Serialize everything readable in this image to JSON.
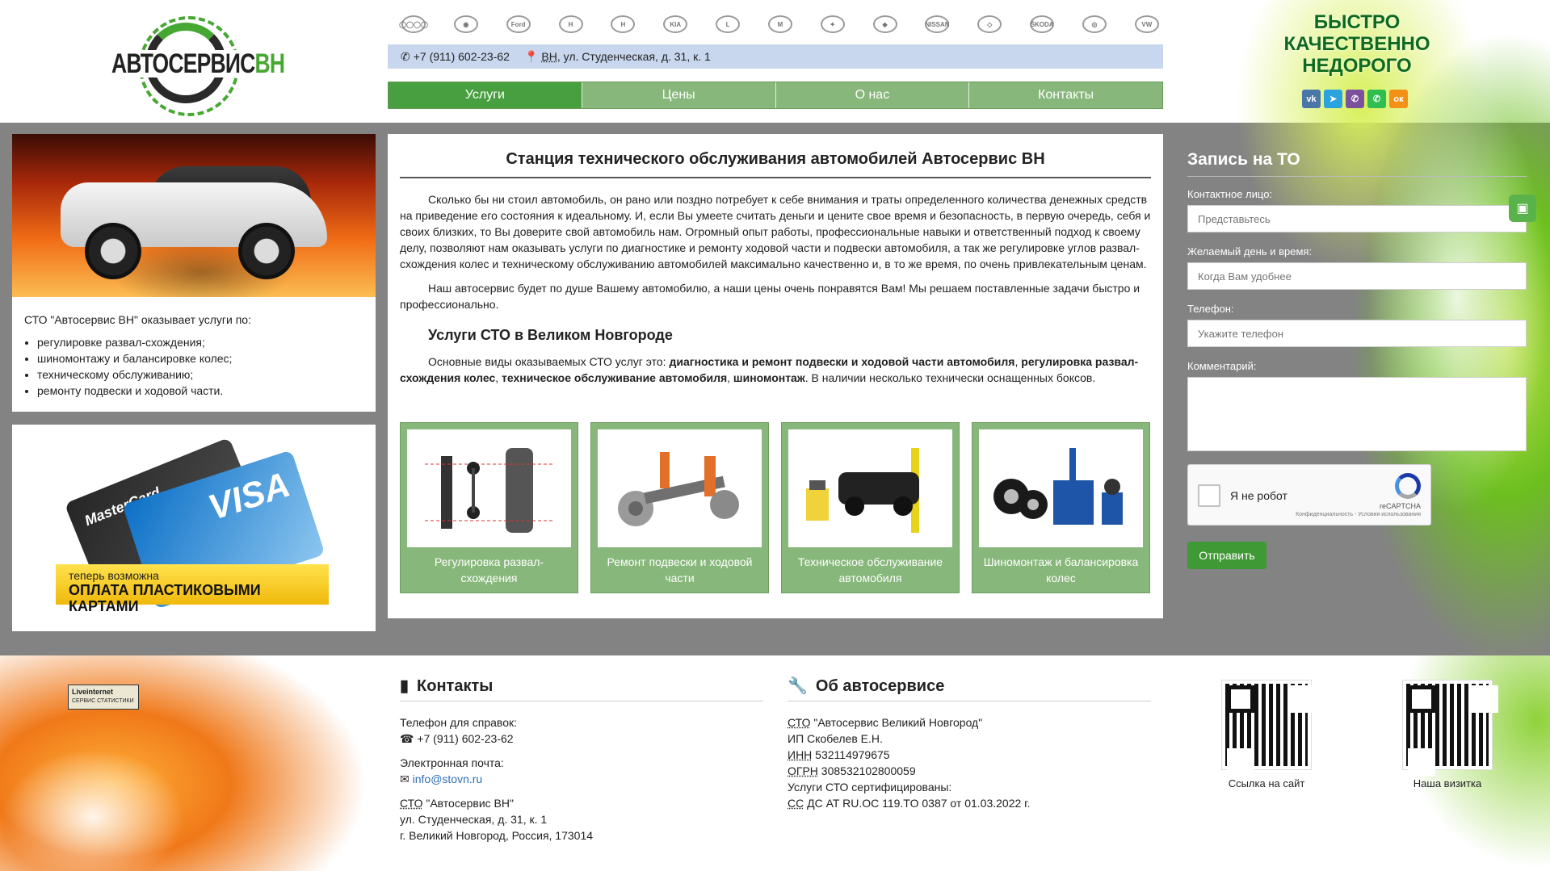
{
  "header": {
    "logo_word": "АВТОСЕРВИС",
    "logo_accent": "ВН",
    "brands": [
      {
        "name": "audi-logo-icon",
        "glyph": "◯◯◯◯"
      },
      {
        "name": "bmw-logo-icon",
        "glyph": "◉"
      },
      {
        "name": "ford-logo-icon",
        "glyph": "Ford"
      },
      {
        "name": "honda-logo-icon",
        "glyph": "H"
      },
      {
        "name": "hyundai-logo-icon",
        "glyph": "H"
      },
      {
        "name": "kia-logo-icon",
        "glyph": "KIA"
      },
      {
        "name": "lexus-logo-icon",
        "glyph": "L"
      },
      {
        "name": "mazda-logo-icon",
        "glyph": "M"
      },
      {
        "name": "mercedes-logo-icon",
        "glyph": "✦"
      },
      {
        "name": "mitsubishi-logo-icon",
        "glyph": "◆"
      },
      {
        "name": "nissan-logo-icon",
        "glyph": "NISSAN"
      },
      {
        "name": "renault-logo-icon",
        "glyph": "◇"
      },
      {
        "name": "skoda-logo-icon",
        "glyph": "ŠKODA"
      },
      {
        "name": "toyota-logo-icon",
        "glyph": "◎"
      },
      {
        "name": "volkswagen-logo-icon",
        "glyph": "VW"
      }
    ],
    "phone": "+7 (911) 602-23-62",
    "address_city": "ВН",
    "address_rest": ", ул. Студенческая, д. 31, к. 1",
    "nav": [
      "Услуги",
      "Цены",
      "О нас",
      "Контакты"
    ],
    "slogan": [
      "БЫСТРО",
      "КАЧЕСТВЕННО",
      "НЕДОРОГО"
    ],
    "social": [
      {
        "name": "vk-icon",
        "glyph": "vk",
        "color": "#4a76a8"
      },
      {
        "name": "telegram-icon",
        "glyph": "➤",
        "color": "#2aa3de"
      },
      {
        "name": "viber-icon",
        "glyph": "✆",
        "color": "#7b519d"
      },
      {
        "name": "whatsapp-icon",
        "glyph": "✆",
        "color": "#2fbe4f"
      },
      {
        "name": "odnoklassniki-icon",
        "glyph": "ок",
        "color": "#f29115"
      }
    ]
  },
  "left": {
    "intro": "СТО \"Автосервис ВН\" оказывает услуги по:",
    "services": [
      "регулировке развал-схождения;",
      "шиномонтажу и балансировке колес;",
      "техническому обслуживанию;",
      "ремонту подвески и ходовой части."
    ],
    "pay_line1": "теперь возможна",
    "pay_line2": "ОПЛАТА ПЛАСТИКОВЫМИ КАРТАМИ",
    "card_mc": "MasterCard",
    "card_visa": "VISA"
  },
  "main": {
    "title": "Станция технического обслуживания автомобилей Автосервис ВН",
    "p1": "Сколько бы ни стоил автомобиль, он рано или поздно потребует к себе внимания и траты определенного количества денежных средств на приведение его состояния к идеальному. И, если Вы умеете считать деньги и цените свое время и безопасность, в первую очередь, себя и своих близких, то Вы доверите свой автомобиль нам. Огромный опыт работы, профессиональные навыки и ответственный подход к своему делу, позволяют нам оказывать услуги по диагностике и ремонту ходовой части и подвески автомобиля, а так же регулировке углов развал-схождения колес и техническому обслуживанию автомобилей максимально качественно и, в то же время, по очень привлекательным ценам.",
    "p2": "Наш автосервис будет по душе Вашему автомобилю, а наши цены очень понравятся Вам! Мы решаем поставленные задачи быстро и профессионально.",
    "h2": "Услуги СТО в Великом Новгороде",
    "p3_start": "Основные виды оказываемых СТО услуг это: ",
    "p3_b1": "диагностика и ремонт подвески и ходовой части автомобиля",
    "p3_sep1": ", ",
    "p3_b2": "регулировка развал-схождения колес",
    "p3_sep2": ", ",
    "p3_b3": "техническое обслуживание автомобиля",
    "p3_sep3": ", ",
    "p3_b4": "шиномонтаж",
    "p3_end": ". В наличии несколько технически оснащенных боксов.",
    "tiles": [
      "Регулировка развал-схождения",
      "Ремонт подвески и ходовой части",
      "Техническое обслуживание автомобиля",
      "Шиномонтаж и балансировка колес"
    ]
  },
  "form": {
    "title": "Запись на ТО",
    "contact_label": "Контактное лицо:",
    "contact_placeholder": "Представьтесь",
    "date_label": "Желаемый день и время:",
    "date_placeholder": "Когда Вам удобнее",
    "phone_label": "Телефон:",
    "phone_placeholder": "Укажите телефон",
    "comment_label": "Комментарий:",
    "captcha_text": "Я не робот",
    "captcha_brand": "reCAPTCHA",
    "captcha_links": "Конфиденциальность - Условия использования",
    "submit": "Отправить"
  },
  "footer": {
    "li_title": "Liveinternet",
    "li_sub": "СЕРВИС СТАТИСТИКИ",
    "contacts_title": "Контакты",
    "phone_label": "Телефон для справок:",
    "phone": "+7 (911) 602-23-62",
    "email_label": "Электронная почта:",
    "email": "info@stovn.ru",
    "org_abbr": "СТО",
    "org_name": " \"Автосервис ВН\"",
    "addr1": "ул. Студенческая, д. 31, к. 1",
    "addr2": "г. Великий Новгород, Россия, 173014",
    "about_title": "Об автосервисе",
    "about_abbr": "СТО",
    "about_name": " \"Автосервис Великий Новгород\"",
    "ip": "ИП Скобелев Е.Н.",
    "inn_abbr": "ИНН",
    "inn": " 532114979675",
    "ogrn_abbr": "ОГРН",
    "ogrn": " 308532102800059",
    "cert": "Услуги СТО сертифицированы:",
    "cert_abbr": "СС",
    "cert_num": " ДС AT RU.OC 119.TO 0387 от 01.03.2022 г.",
    "qr1": "Ссылка на сайт",
    "qr2": "Наша визитка"
  }
}
